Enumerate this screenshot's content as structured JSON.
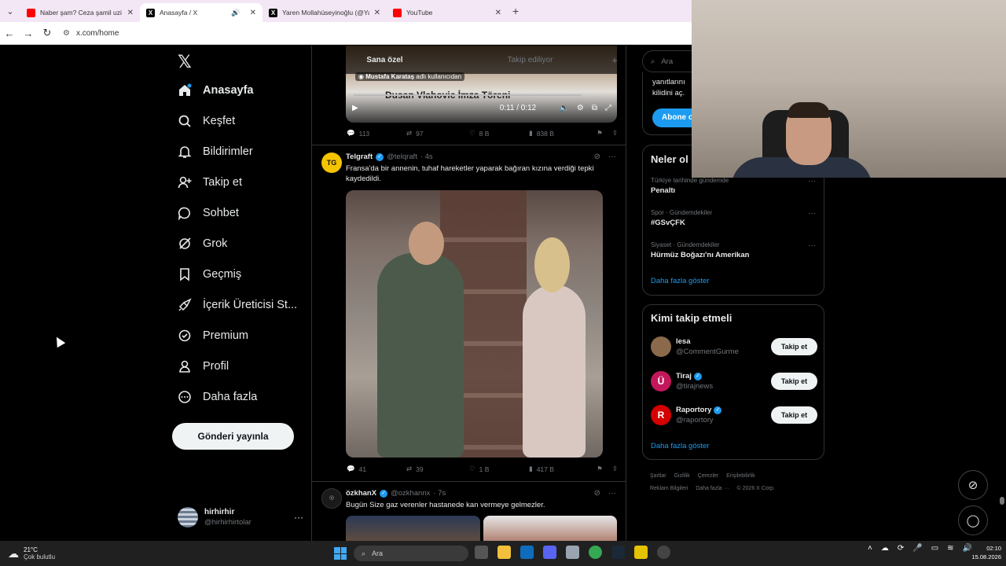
{
  "browser": {
    "tabs": [
      {
        "title": "Naber şam? Ceza şamil uzi mer",
        "icon": "youtube-icon"
      },
      {
        "title": "Anasayfa / X",
        "icon": "x-icon",
        "active": true
      },
      {
        "title": "Yaren Mollahüseyinoğlu (@Yar",
        "icon": "x-icon"
      },
      {
        "title": "YouTube",
        "icon": "youtube-icon"
      }
    ],
    "url": "x.com/home"
  },
  "nav": {
    "items": [
      {
        "label": "Anasayfa",
        "icon": "home-icon"
      },
      {
        "label": "Keşfet",
        "icon": "search-icon"
      },
      {
        "label": "Bildirimler",
        "icon": "bell-icon"
      },
      {
        "label": "Takip et",
        "icon": "person-add-icon"
      },
      {
        "label": "Sohbet",
        "icon": "chat-icon"
      },
      {
        "label": "Grok",
        "icon": "grok-icon"
      },
      {
        "label": "Geçmiş",
        "icon": "bookmark-icon"
      },
      {
        "label": "İçerik Üreticisi St...",
        "icon": "rocket-icon"
      },
      {
        "label": "Premium",
        "icon": "premium-icon"
      },
      {
        "label": "Profil",
        "icon": "profile-icon"
      },
      {
        "label": "Daha fazla",
        "icon": "more-circle-icon"
      }
    ],
    "post_button": "Gönderi yayınla",
    "account": {
      "name": "hirhirhir",
      "handle": "@hirhirhirtolar"
    }
  },
  "timeline": {
    "tabs": [
      "Sana özel",
      "Takip ediliyor"
    ],
    "post1": {
      "uploader_name": "Mustafa Karataş",
      "uploader_suffix": "adlı kullanıcıdan",
      "video_title": "Dusan Vlahovic İmza Töreni",
      "time": "0:11 / 0:12",
      "replies": "113",
      "reposts": "97",
      "likes": "8 B",
      "views": "838 B"
    },
    "post2": {
      "name": "Telgraft",
      "handle": "@telqraft",
      "time": "· 4s",
      "avatar_text": "TG",
      "text": "Fransa'da bir annenin, tuhaf hareketler yaparak bağıran kızına verdiği tepki kaydedildi.",
      "replies": "41",
      "reposts": "39",
      "likes": "1 B",
      "views": "417 B"
    },
    "post3": {
      "name": "özkhanX",
      "handle": "@ozkhannx",
      "time": "· 7s",
      "text": "Bugün Size gaz verenler hastanede kan vermeye gelmezler."
    }
  },
  "sidebar": {
    "search_placeholder": "Ara",
    "premium": {
      "text": "yanıtlarını kilidini aç.",
      "button": "Abone o"
    },
    "trends": {
      "title": "Neler ol",
      "items": [
        {
          "context": "Türkiye tarihinde gündemde",
          "title": "Penaltı"
        },
        {
          "context": "Spor · Gündemdekiler",
          "title": "#GSvÇFK"
        },
        {
          "context": "Siyaset · Gündemdekiler",
          "title": "Hürmüz Boğazı'nı Amerikan"
        }
      ],
      "show_more": "Daha fazla göster"
    },
    "who_to_follow": {
      "title": "Kimi takip etmeli",
      "users": [
        {
          "name": "lesa",
          "handle": "@CommentGurme",
          "verified": false,
          "color": "#8a6a4a"
        },
        {
          "name": "Tiraj",
          "handle": "@tirajnews",
          "verified": true,
          "color": "#c2185b"
        },
        {
          "name": "Raportory",
          "handle": "@raportory",
          "verified": true,
          "color": "#d50000"
        }
      ],
      "follow_label": "Takip et",
      "show_more": "Daha fazla göster"
    },
    "footer": [
      "Şartlar",
      "Gizlilik",
      "Çerezler",
      "Erişilebilirlik",
      "Reklam Bilgileri",
      "Daha fazla ···",
      "© 2026 X Corp."
    ]
  },
  "taskbar": {
    "weather_temp": "21°C",
    "weather_desc": "Çok bulutlu",
    "search_label": "Ara",
    "time": "02:10",
    "date": "15.08.2026"
  },
  "colors": {
    "accent": "#1d9bf0",
    "bg": "#000000",
    "border": "#2f3336",
    "muted": "#71767b"
  }
}
